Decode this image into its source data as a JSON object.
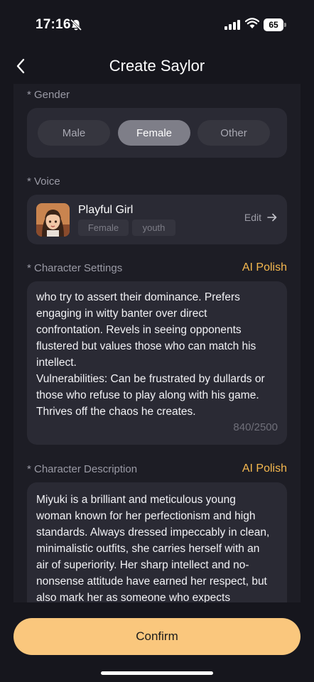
{
  "status_bar": {
    "time": "17:16",
    "battery": "65"
  },
  "header": {
    "title": "Create Saylor"
  },
  "gender": {
    "label": "* Gender",
    "options": [
      "Male",
      "Female",
      "Other"
    ],
    "selected": "Female"
  },
  "voice": {
    "label": "* Voice",
    "name": "Playful Girl",
    "tags": [
      "Female",
      "youth"
    ],
    "edit_label": "Edit"
  },
  "character_settings": {
    "label": "* Character Settings",
    "ai_polish": "AI Polish",
    "text_lines": [
      "who try to assert their dominance. Prefers",
      "engaging in witty banter over direct",
      "confrontation. Revels in seeing opponents",
      "flustered but values those who can match his",
      "intellect.",
      "Vulnerabilities: Can be frustrated by dullards or",
      "those who refuse to play along with his game.",
      "Thrives off the chaos he creates."
    ],
    "counter": "840/2500"
  },
  "character_description": {
    "label": "* Character Description",
    "ai_polish": "AI Polish",
    "text_lines": [
      "Miyuki is a brilliant and meticulous young",
      "woman known for her perfectionism and high",
      "standards. Always dressed impeccably in clean,",
      "minimalistic outfits, she carries herself with an",
      "air of superiority. Her sharp intellect and no-",
      "nonsense attitude have earned her respect, but",
      "also mark her as someone who expects"
    ]
  },
  "footer": {
    "confirm_label": "Confirm"
  },
  "colors": {
    "accent": "#f6b94f",
    "confirm": "#fac77d",
    "background": "#16161d",
    "card": "#2a2a34"
  }
}
